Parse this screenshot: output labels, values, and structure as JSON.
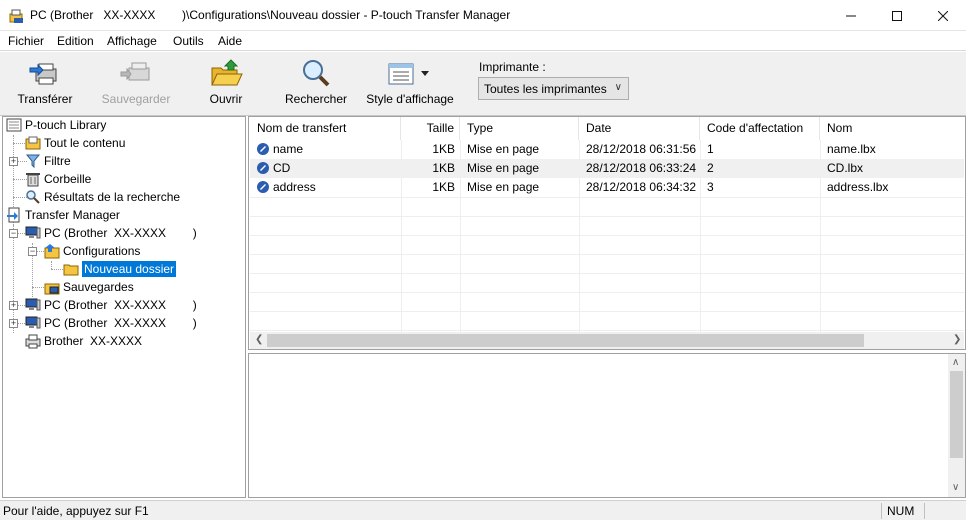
{
  "window": {
    "title": "PC (Brother   XX-XXXX        )\\Configurations\\Nouveau dossier - P-touch Transfer Manager",
    "controls": [
      "minimize",
      "maximize",
      "close"
    ]
  },
  "menu": [
    "Fichier",
    "Edition",
    "Affichage",
    "Outils",
    "Aide"
  ],
  "toolbar": {
    "buttons": [
      {
        "label": "Transférer",
        "icon": "transfer-printer-icon",
        "enabled": true
      },
      {
        "label": "Sauvegarder",
        "icon": "backup-printer-icon",
        "enabled": false
      },
      {
        "label": "Ouvrir",
        "icon": "open-folder-icon",
        "enabled": true
      },
      {
        "label": "Rechercher",
        "icon": "magnifier-icon",
        "enabled": true
      },
      {
        "label": "Style d'affichage",
        "icon": "view-style-icon",
        "enabled": true
      }
    ],
    "printer_label": "Imprimante :",
    "printer_value": "Toutes les imprimantes"
  },
  "tree": {
    "library": "P-touch Library",
    "all_contents": "Tout le contenu",
    "filter": "Filtre",
    "trash": "Corbeille",
    "search_results": "Résultats de la recherche",
    "transfer_manager": "Transfer Manager",
    "pc1": "PC (Brother  XX-XXXX        )",
    "configurations": "Configurations",
    "new_folder": "Nouveau dossier",
    "backups": "Sauvegardes",
    "pc2": "PC (Brother  XX-XXXX        )",
    "pc3": "PC (Brother  XX-XXXX        )",
    "printer": "Brother  XX-XXXX"
  },
  "list": {
    "columns": [
      "Nom de transfert",
      "Taille",
      "Type",
      "Date",
      "Code d'affectation",
      "Nom"
    ],
    "rows": [
      {
        "name": "name",
        "size": "1KB",
        "type": "Mise en page",
        "date": "28/12/2018 06:31:56",
        "code": "1",
        "file": "name.lbx"
      },
      {
        "name": "CD",
        "size": "1KB",
        "type": "Mise en page",
        "date": "28/12/2018 06:33:24",
        "code": "2",
        "file": "CD.lbx"
      },
      {
        "name": "address",
        "size": "1KB",
        "type": "Mise en page",
        "date": "28/12/2018 06:34:32",
        "code": "3",
        "file": "address.lbx"
      }
    ]
  },
  "status": {
    "help": "Pour l'aide, appuyez sur F1",
    "num": "NUM"
  },
  "colors": {
    "selection": "#0078d7",
    "toolbar_bg": "#f0f0f0",
    "folder_yellow": "#f5c542"
  }
}
